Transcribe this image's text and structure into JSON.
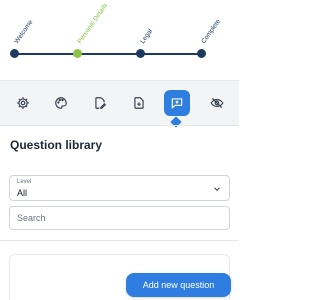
{
  "stepper": {
    "steps": [
      {
        "label": "Welcome",
        "state": "complete"
      },
      {
        "label": "Personal Details",
        "state": "current"
      },
      {
        "label": "Legal",
        "state": "complete"
      },
      {
        "label": "Complete",
        "state": "complete"
      }
    ],
    "colors": {
      "track": "#1e3a5f",
      "current": "#8bc34a"
    }
  },
  "toolbar": {
    "items": [
      {
        "icon": "gear-icon",
        "active": false
      },
      {
        "icon": "palette-icon",
        "active": false
      },
      {
        "icon": "edit-document-icon",
        "active": false
      },
      {
        "icon": "add-file-icon",
        "active": false
      },
      {
        "icon": "chat-add-icon",
        "active": true
      },
      {
        "icon": "eye-off-icon",
        "active": false
      }
    ],
    "accent_color": "#2f7de1"
  },
  "question_library": {
    "title": "Question library",
    "level_filter": {
      "caption": "Level",
      "value": "All"
    },
    "search": {
      "placeholder": "Search",
      "value": ""
    },
    "add_button_label": "Add new question"
  }
}
